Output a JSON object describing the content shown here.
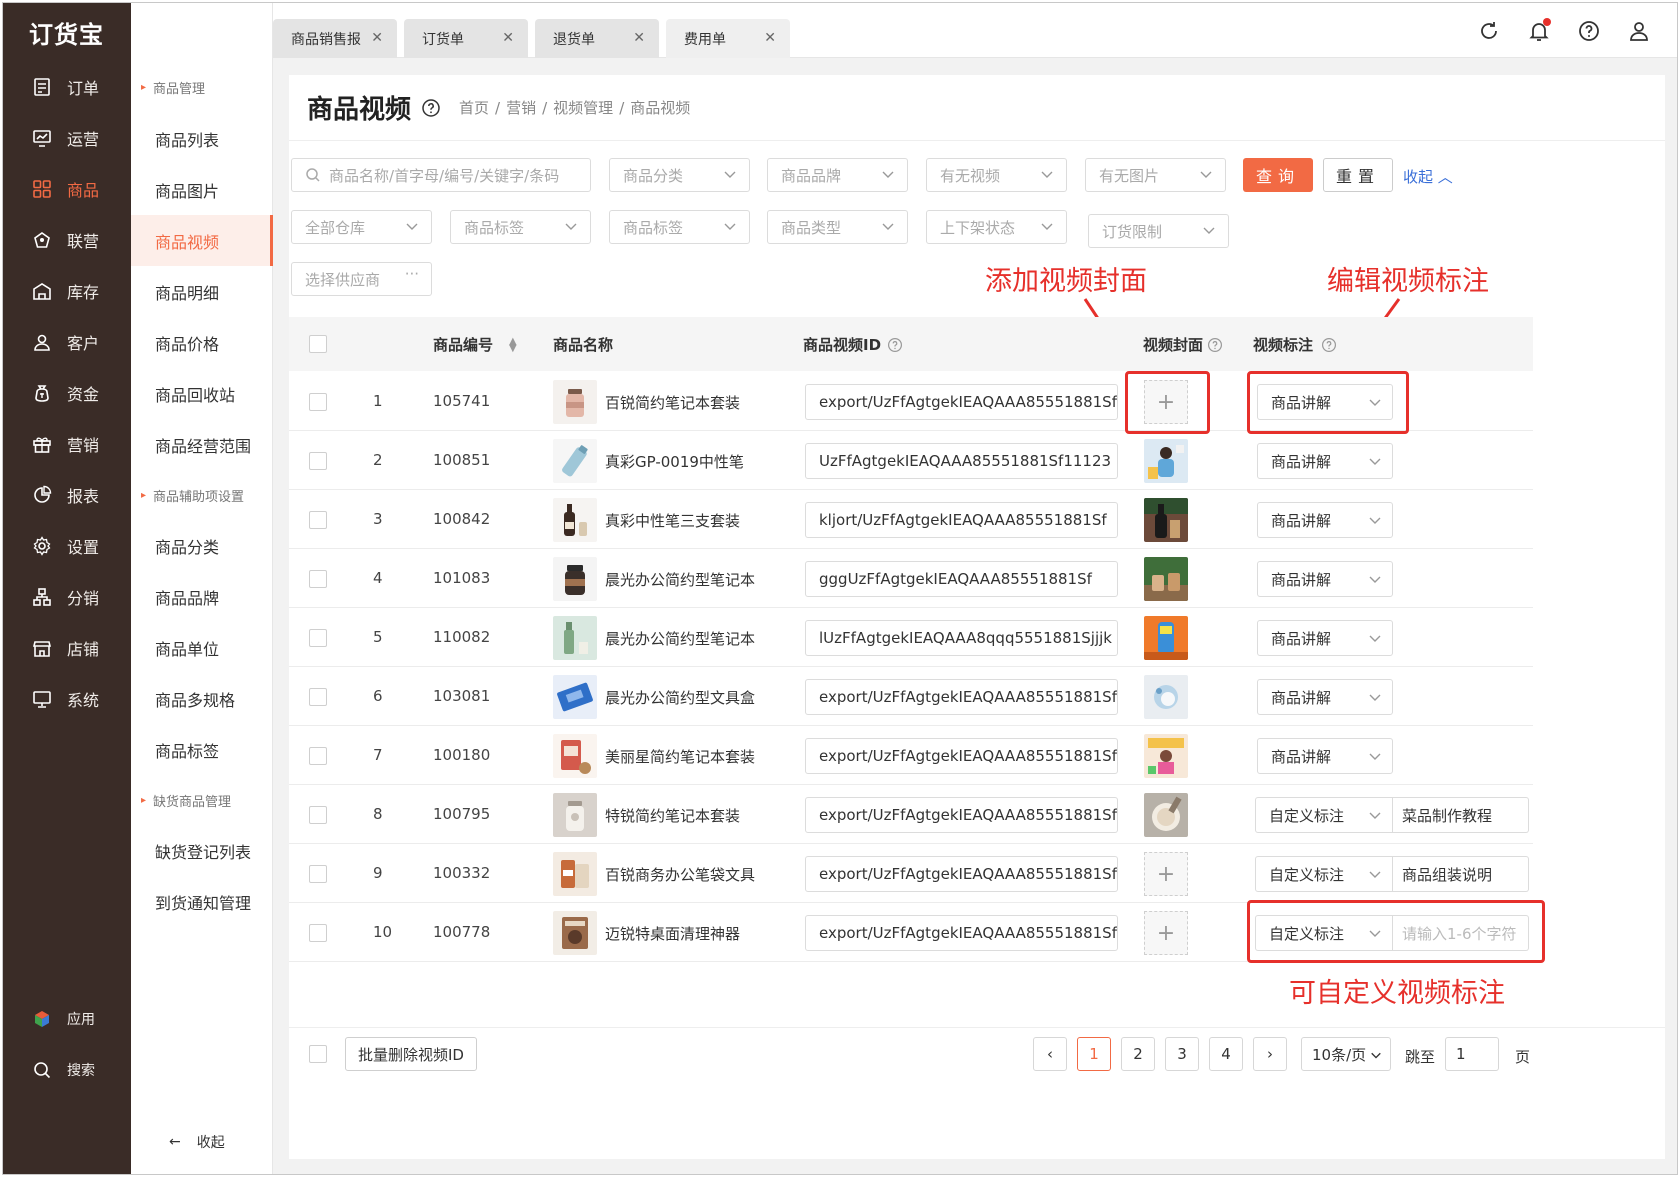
{
  "app": {
    "logo": "订货宝"
  },
  "nav": {
    "items": [
      {
        "label": "订单",
        "icon": "order-icon"
      },
      {
        "label": "运营",
        "icon": "operations-icon"
      },
      {
        "label": "商品",
        "icon": "product-grid-icon",
        "active": true
      },
      {
        "label": "联营",
        "icon": "joint-icon"
      },
      {
        "label": "库存",
        "icon": "warehouse-icon"
      },
      {
        "label": "客户",
        "icon": "customer-icon"
      },
      {
        "label": "资金",
        "icon": "money-bag-icon"
      },
      {
        "label": "营销",
        "icon": "gift-icon"
      },
      {
        "label": "报表",
        "icon": "pie-chart-icon"
      },
      {
        "label": "设置",
        "icon": "gear-icon"
      },
      {
        "label": "分销",
        "icon": "distribution-icon"
      },
      {
        "label": "店铺",
        "icon": "store-icon"
      },
      {
        "label": "系统",
        "icon": "monitor-icon"
      }
    ],
    "bottom": [
      {
        "label": "应用",
        "icon": "apps-cube-icon"
      },
      {
        "label": "搜索",
        "icon": "search-icon"
      }
    ]
  },
  "submenu": {
    "group1": "商品管理",
    "items1": [
      "商品列表",
      "商品图片",
      "商品视频",
      "商品明细",
      "商品价格",
      "商品回收站",
      "商品经营范围"
    ],
    "group2": "商品辅助项设置",
    "items2": [
      "商品分类",
      "商品品牌",
      "商品单位",
      "商品多规格",
      "商品标签"
    ],
    "group3": "缺货商品管理",
    "items3": [
      "缺货登记列表",
      "到货通知管理"
    ],
    "collapse": "收起"
  },
  "tabs": [
    "商品销售报",
    "订货单",
    "退货单",
    "费用单"
  ],
  "page": {
    "title": "商品视频",
    "breadcrumb": [
      "首页",
      "营销",
      "视频管理",
      "商品视频"
    ]
  },
  "filters": {
    "search_placeholder": "商品名称/首字母/编号/关键字/条码",
    "category": "商品分类",
    "brand": "商品品牌",
    "has_video": "有无视频",
    "has_image": "有无图片",
    "warehouse": "全部仓库",
    "tag1": "商品标签",
    "tag2": "商品标签",
    "type": "商品类型",
    "shelf": "上下架状态",
    "order_limit": "订货限制",
    "supplier": "选择供应商",
    "query": "查询",
    "reset": "重置",
    "collapse": "收起"
  },
  "annotations": {
    "add_cover": "添加视频封面",
    "edit_tag": "编辑视频标注",
    "custom_tag": "可自定义视频标注"
  },
  "table": {
    "headers": {
      "code": "商品编号",
      "name": "商品名称",
      "video_id": "商品视频ID",
      "cover": "视频封面",
      "tag": "视频标注"
    },
    "rows": [
      {
        "idx": "1",
        "code": "105741",
        "name": "百锐简约笔记本套装",
        "video_id": "export/UzFfAgtgekIEAQAAA85551881Sf",
        "cover": "",
        "tag": "商品讲解",
        "custom": ""
      },
      {
        "idx": "2",
        "code": "100851",
        "name": "真彩GP-0019中性笔",
        "video_id": "UzFfAgtgekIEAQAAA85551881Sf11123",
        "cover": "photo",
        "tag": "商品讲解",
        "custom": ""
      },
      {
        "idx": "3",
        "code": "100842",
        "name": "真彩中性笔三支套装",
        "video_id": "kljort/UzFfAgtgekIEAQAAA85551881Sf",
        "cover": "photo",
        "tag": "商品讲解",
        "custom": ""
      },
      {
        "idx": "4",
        "code": "101083",
        "name": "晨光办公简约型笔记本",
        "video_id": "gggUzFfAgtgekIEAQAAA85551881Sf",
        "cover": "photo",
        "tag": "商品讲解",
        "custom": ""
      },
      {
        "idx": "5",
        "code": "110082",
        "name": "晨光办公简约型笔记本",
        "video_id": "lUzFfAgtgekIEAQAAA8qqq5551881Sjjjk",
        "cover": "photo",
        "tag": "商品讲解",
        "custom": ""
      },
      {
        "idx": "6",
        "code": "103081",
        "name": "晨光办公简约型文具盒",
        "video_id": "export/UzFfAgtgekIEAQAAA85551881Sf",
        "cover": "photo",
        "tag": "商品讲解",
        "custom": ""
      },
      {
        "idx": "7",
        "code": "100180",
        "name": "美丽星简约笔记本套装",
        "video_id": "export/UzFfAgtgekIEAQAAA85551881Sf",
        "cover": "photo",
        "tag": "商品讲解",
        "custom": ""
      },
      {
        "idx": "8",
        "code": "100795",
        "name": "特锐简约笔记本套装",
        "video_id": "export/UzFfAgtgekIEAQAAA85551881Sf",
        "cover": "photo",
        "tag": "自定义标注",
        "custom": "菜品制作教程"
      },
      {
        "idx": "9",
        "code": "100332",
        "name": "百锐商务办公笔袋文具",
        "video_id": "export/UzFfAgtgekIEAQAAA85551881Sf",
        "cover": "",
        "tag": "自定义标注",
        "custom": "商品组装说明"
      },
      {
        "idx": "10",
        "code": "100778",
        "name": "迈锐特桌面清理神器",
        "video_id": "export/UzFfAgtgekIEAQAAA85551881Sf",
        "cover": "",
        "tag": "自定义标注",
        "custom_placeholder": "请输入1-6个字符"
      }
    ]
  },
  "footer": {
    "batch_delete": "批量删除视频ID",
    "pages": [
      "1",
      "2",
      "3",
      "4"
    ],
    "current_page": "1",
    "page_size": "10条/页",
    "jump_label": "跳至",
    "jump_value": "1",
    "page_unit": "页"
  },
  "colors": {
    "accent": "#f26a44",
    "nav_bg": "#3a2c27",
    "annotation": "#e6302b",
    "link": "#3a6fd8"
  }
}
